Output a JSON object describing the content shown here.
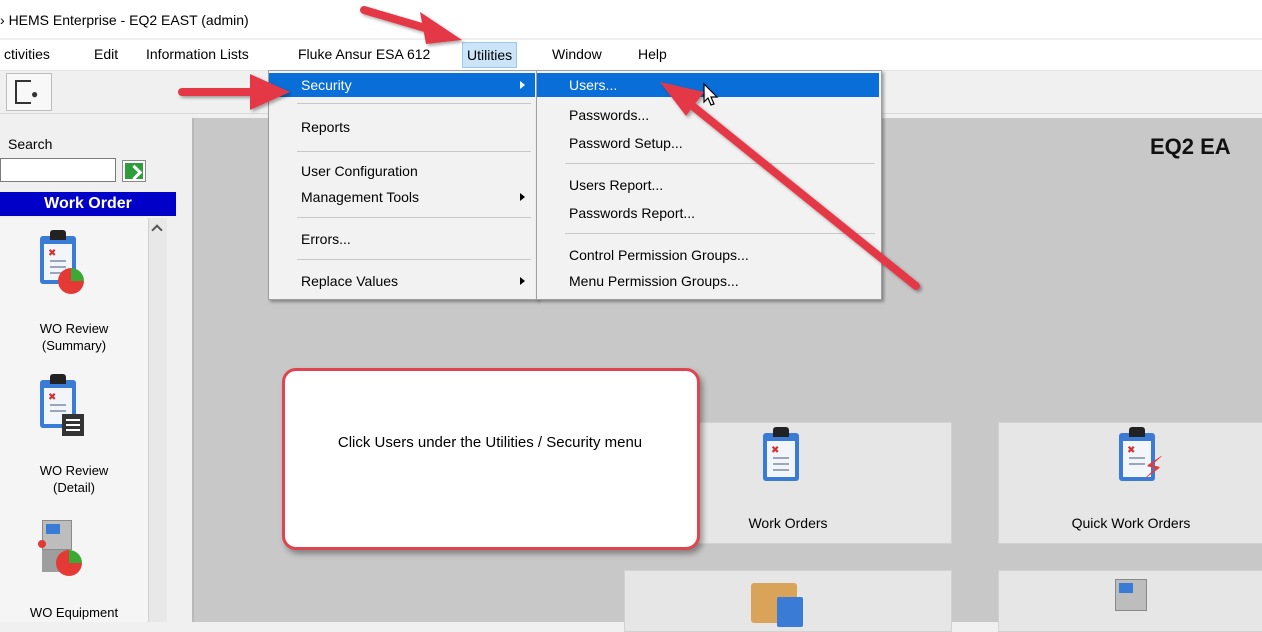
{
  "window": {
    "title": "HEMS Enterprise - EQ2 EAST (admin)"
  },
  "menubar": {
    "items": [
      {
        "label": "ctivities"
      },
      {
        "label": "Edit"
      },
      {
        "label": "Information Lists"
      },
      {
        "label": "Fluke Ansur ESA 612"
      },
      {
        "label": "Utilities",
        "active": true
      },
      {
        "label": "Window"
      },
      {
        "label": "Help"
      }
    ]
  },
  "toolbar": {
    "exit_icon": "exit-door-icon"
  },
  "sidebar": {
    "search_label": "Search",
    "search_value": "",
    "go_icon": "green-arrow-icon",
    "section_header": "Work Order",
    "items": [
      {
        "label": "WO Review\n(Summary)",
        "icon": "clipboard-pie-icon"
      },
      {
        "label": "WO Review\n(Detail)",
        "icon": "clipboard-list-icon"
      },
      {
        "label": "WO Equipment",
        "icon": "device-pie-icon"
      }
    ]
  },
  "utilities_menu": {
    "items": [
      {
        "label": "Security",
        "has_submenu": true,
        "highlighted": true
      },
      {
        "label": "Reports"
      },
      {
        "label": "User Configuration"
      },
      {
        "label": "Management Tools",
        "has_submenu": true
      },
      {
        "label": "Errors..."
      },
      {
        "label": "Replace Values",
        "has_submenu": true
      }
    ]
  },
  "security_submenu": {
    "items": [
      {
        "label": "Users...",
        "highlighted": true
      },
      {
        "label": "Passwords..."
      },
      {
        "label": "Password Setup..."
      },
      {
        "label": "Users Report..."
      },
      {
        "label": "Passwords Report..."
      },
      {
        "label": "Control Permission Groups..."
      },
      {
        "label": "Menu Permission Groups..."
      }
    ]
  },
  "workspace": {
    "title": "EQ2 EA",
    "tiles": [
      {
        "label": "Work Orders",
        "icon": "clipboard-icon"
      },
      {
        "label": "Quick Work Orders",
        "icon": "clipboard-lightning-icon"
      },
      {
        "label": "",
        "icon": "box-clipboard-icon"
      },
      {
        "label": "",
        "icon": "device-icon"
      }
    ]
  },
  "callout": {
    "text": "Click Users under the Utilities / Security menu"
  },
  "colors": {
    "menu_highlight": "#0a6ed8",
    "annotation_red": "#e0454f",
    "header_blue": "#0000c8"
  }
}
